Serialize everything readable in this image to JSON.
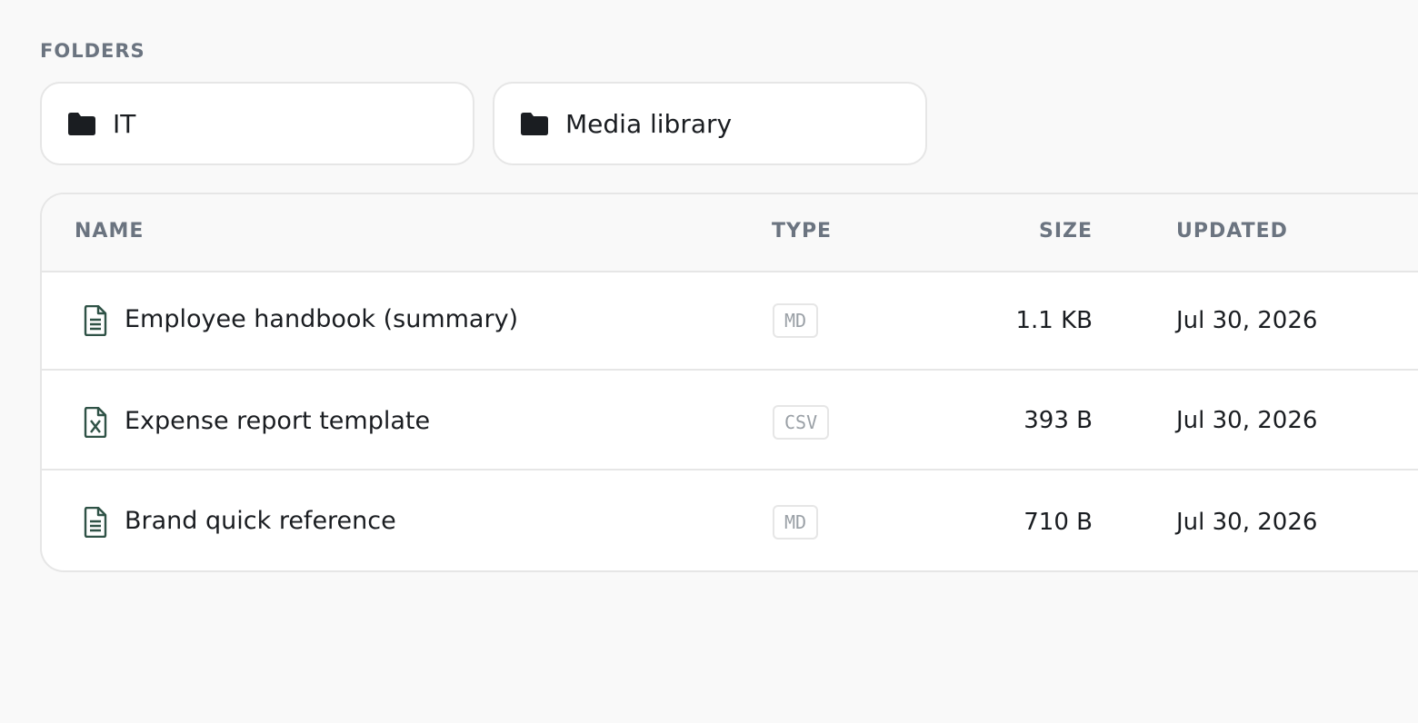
{
  "folders_section": {
    "label": "FOLDERS",
    "folders": [
      {
        "name": "IT",
        "icon": "folder-icon"
      },
      {
        "name": "Media library",
        "icon": "folder-icon"
      }
    ]
  },
  "files_table": {
    "columns": {
      "name": "NAME",
      "type": "TYPE",
      "size": "SIZE",
      "updated": "UPDATED"
    },
    "rows": [
      {
        "name": "Employee handbook (summary)",
        "type": "MD",
        "size": "1.1 KB",
        "updated": "Jul 30, 2026",
        "icon": "document-icon"
      },
      {
        "name": "Expense report template",
        "type": "CSV",
        "size": "393 B",
        "updated": "Jul 30, 2026",
        "icon": "spreadsheet-icon"
      },
      {
        "name": "Brand quick reference",
        "type": "MD",
        "size": "710 B",
        "updated": "Jul 30, 2026",
        "icon": "document-icon"
      }
    ]
  },
  "colors": {
    "background": "#f9f9f9",
    "card": "#ffffff",
    "border": "#e6e6e6",
    "muted_text": "#6b7480",
    "file_icon": "#2f5246",
    "folder_icon": "#1a1d21"
  }
}
